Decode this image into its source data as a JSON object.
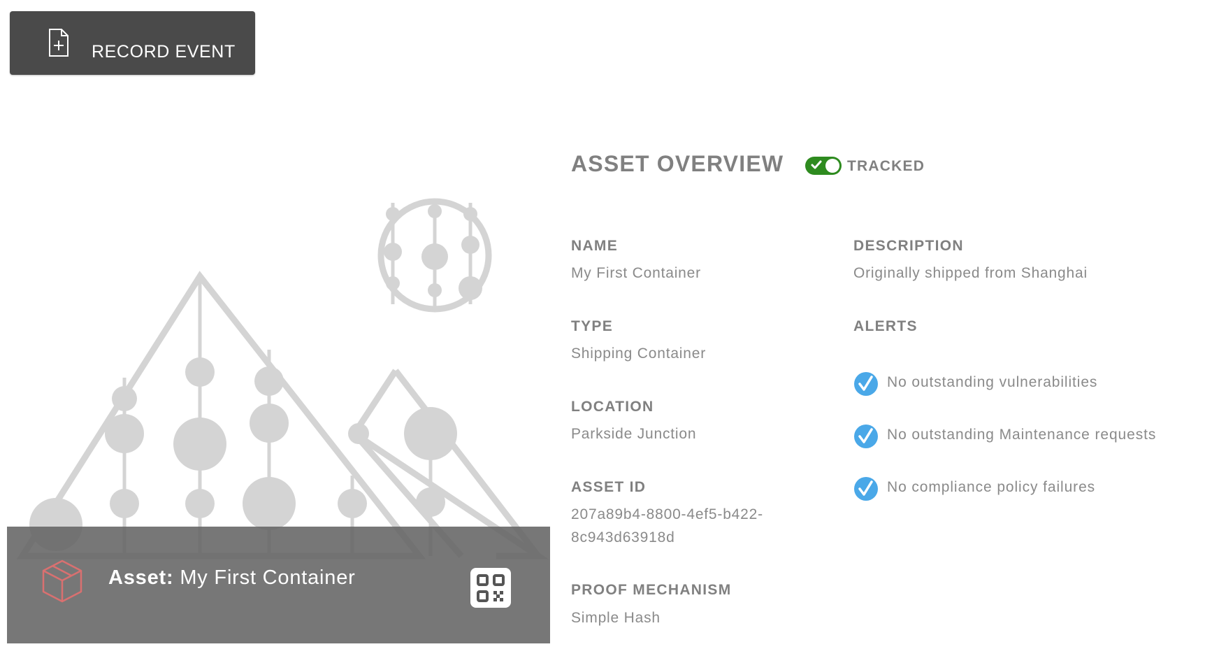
{
  "toolbar": {
    "record_event_label": "RECORD EVENT",
    "record_event_icon": "document-plus-icon"
  },
  "hero": {
    "asset_prefix": "Asset:",
    "asset_name": "My First Container",
    "asset_icon": "cube-icon",
    "qr_icon": "qr-code-icon",
    "cube_color": "#d97070"
  },
  "overview": {
    "title": "ASSET OVERVIEW",
    "tracked_label": "TRACKED",
    "tracked": true,
    "toggle_color": "#2e8b1f"
  },
  "fields": {
    "name": {
      "label": "NAME",
      "value": "My First Container"
    },
    "type": {
      "label": "TYPE",
      "value": "Shipping Container"
    },
    "location": {
      "label": "LOCATION",
      "value": "Parkside Junction"
    },
    "asset_id": {
      "label": "ASSET ID",
      "value_line1": "207a89b4-8800-4ef5-b422-",
      "value_line2": "8c943d63918d"
    },
    "proof_mechanism": {
      "label": "PROOF MECHANISM",
      "value": "Simple Hash"
    },
    "description": {
      "label": "DESCRIPTION",
      "value": "Originally shipped from Shanghai"
    }
  },
  "alerts": {
    "label": "ALERTS",
    "icon": "check-circle-icon",
    "icon_color": "#4aa8e8",
    "items": [
      "No outstanding vulnerabilities",
      "No outstanding Maintenance requests",
      "No compliance policy failures"
    ]
  }
}
